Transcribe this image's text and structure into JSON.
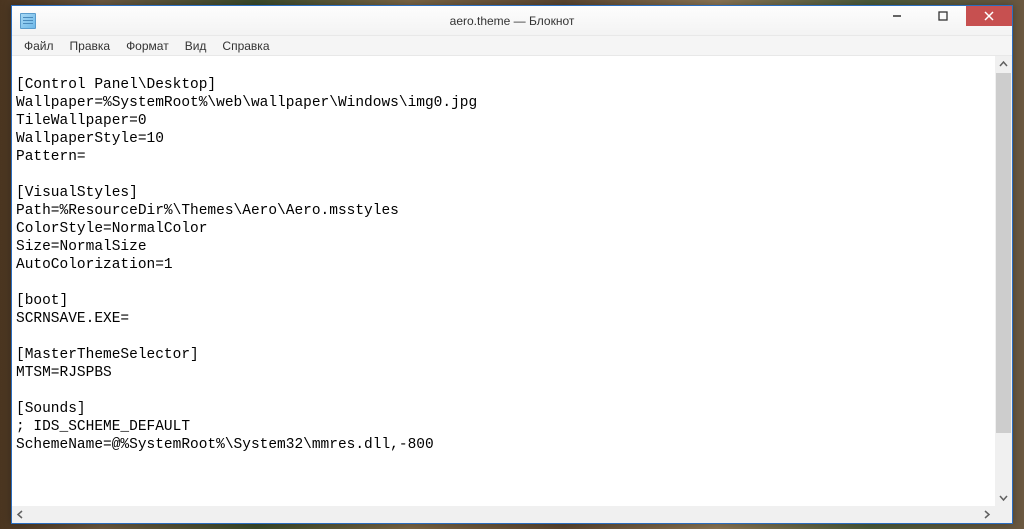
{
  "window": {
    "title": "aero.theme — Блокнот"
  },
  "menu": {
    "file": "Файл",
    "edit": "Правка",
    "format": "Формат",
    "view": "Вид",
    "help": "Справка"
  },
  "content": "\n[Control Panel\\Desktop]\nWallpaper=%SystemRoot%\\web\\wallpaper\\Windows\\img0.jpg\nTileWallpaper=0\nWallpaperStyle=10\nPattern=\n\n[VisualStyles]\nPath=%ResourceDir%\\Themes\\Aero\\Aero.msstyles\nColorStyle=NormalColor\nSize=NormalSize\nAutoColorization=1\n\n[boot]\nSCRNSAVE.EXE=\n\n[MasterThemeSelector]\nMTSM=RJSPBS\n\n[Sounds]\n; IDS_SCHEME_DEFAULT\nSchemeName=@%SystemRoot%\\System32\\mmres.dll,-800"
}
